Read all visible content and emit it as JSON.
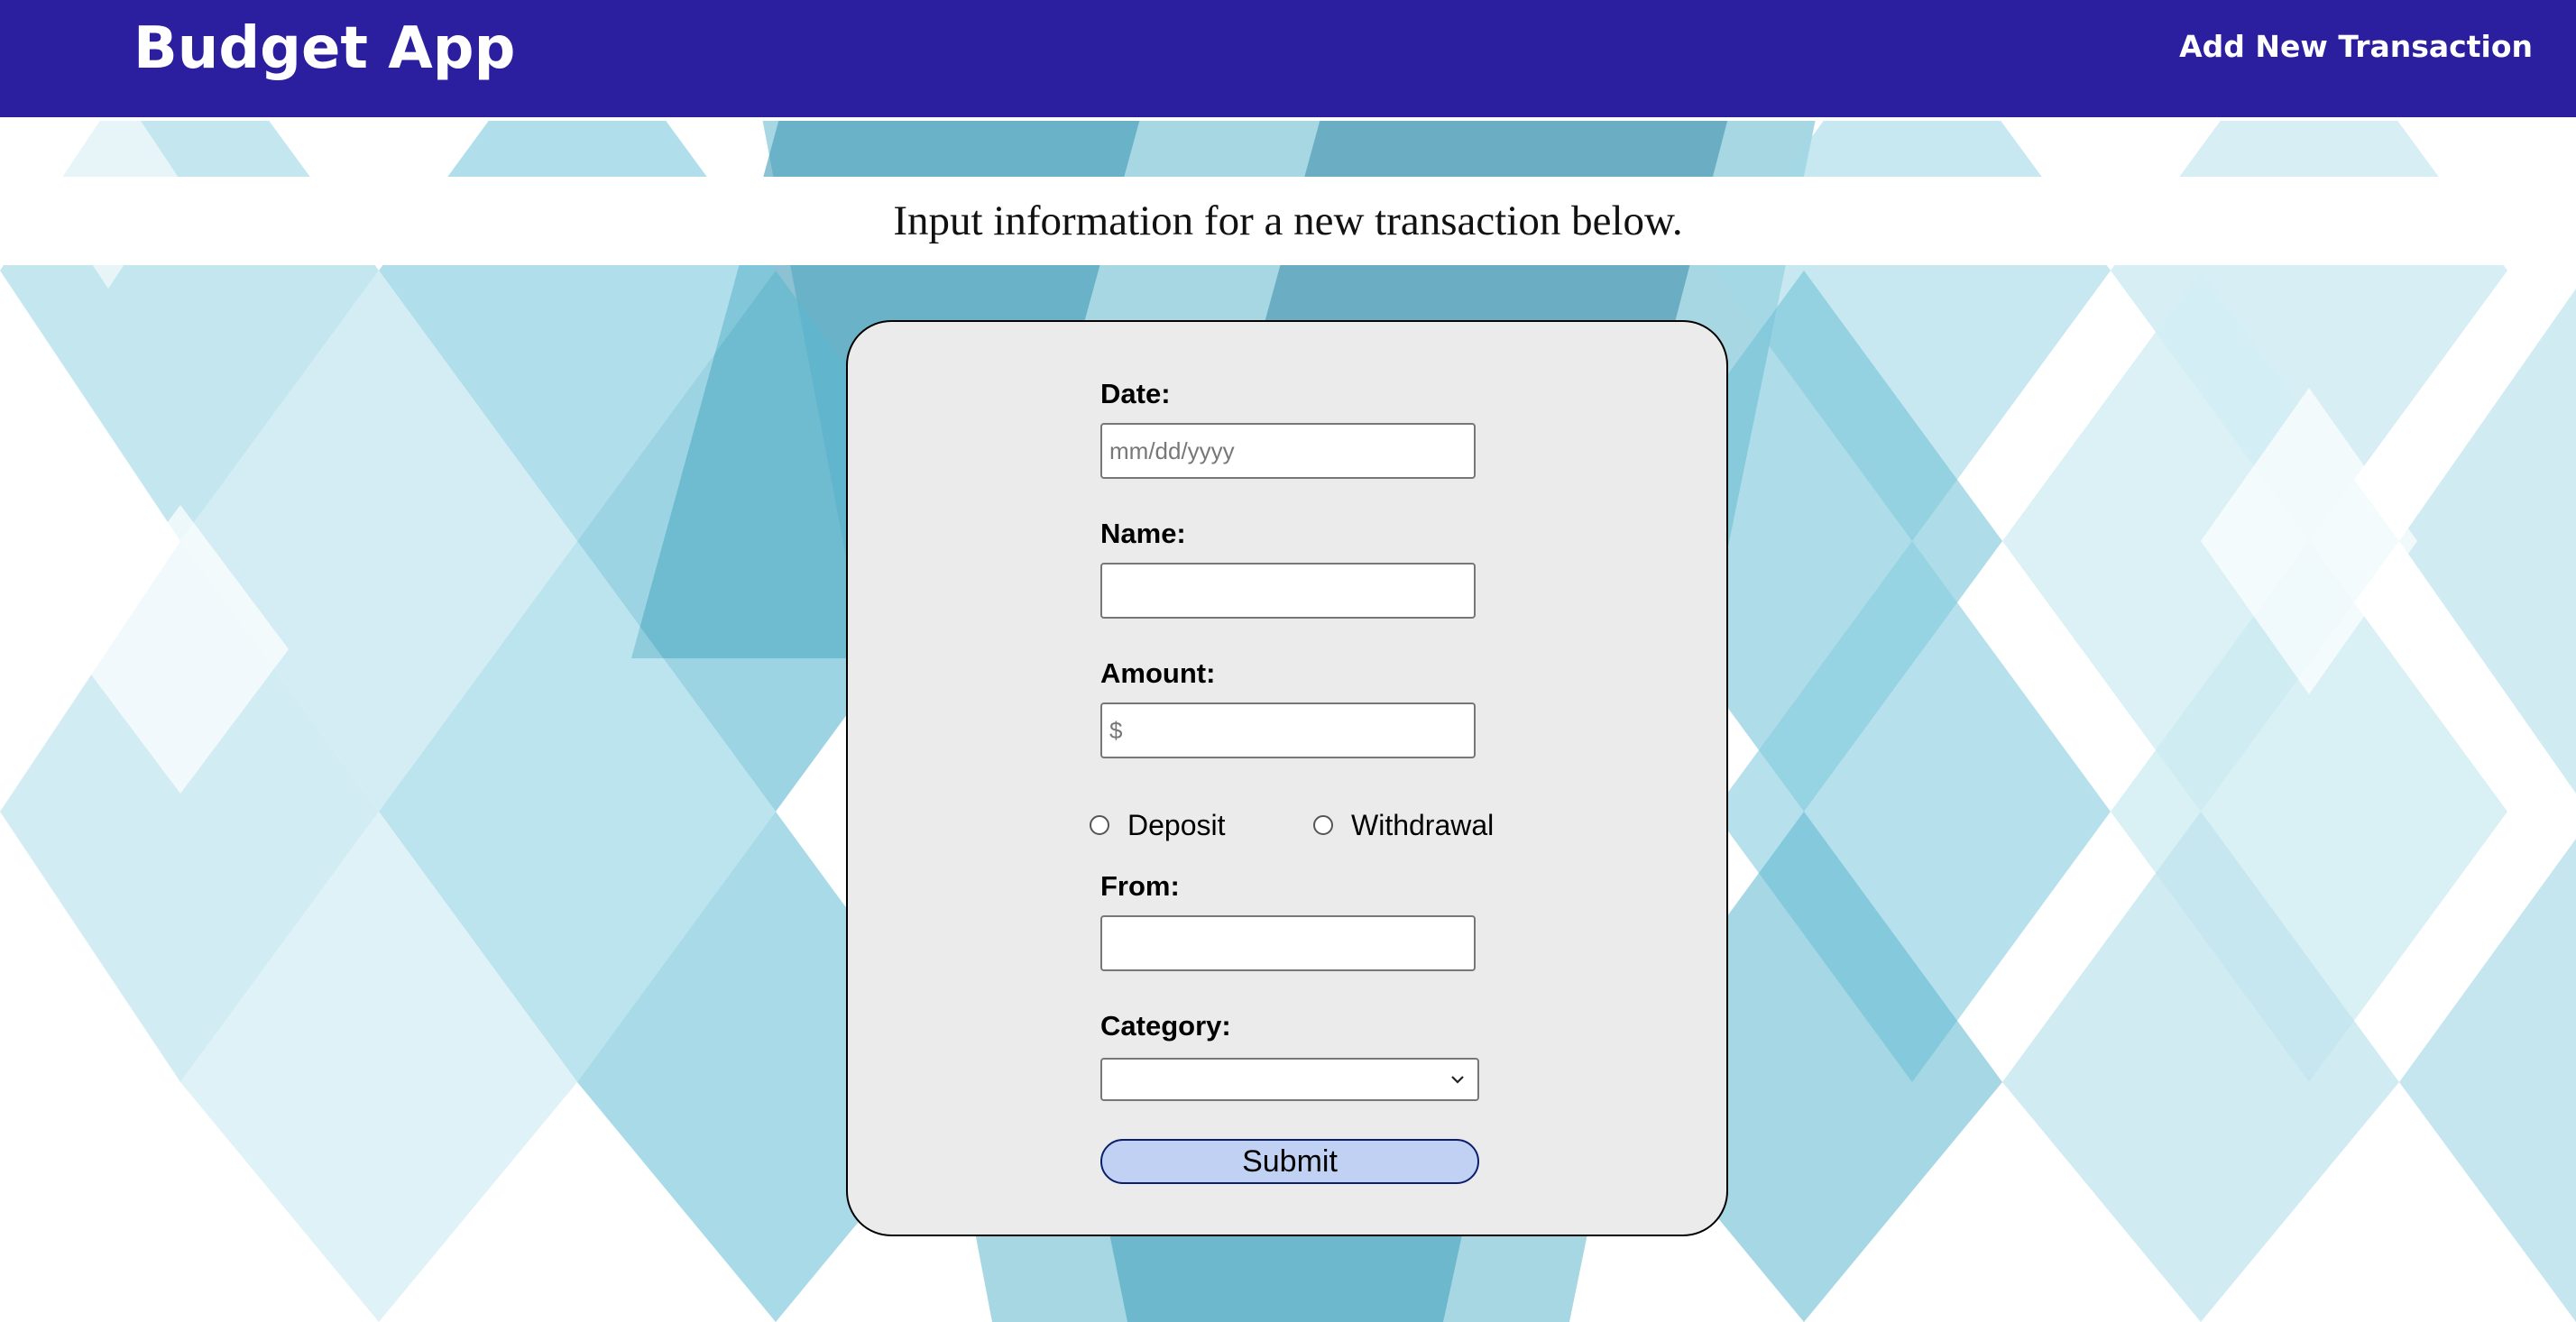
{
  "navbar": {
    "brand": "Budget App",
    "link": "Add New Transaction"
  },
  "banner": {
    "text": "Input information for a new transaction below."
  },
  "form": {
    "date": {
      "label": "Date:",
      "placeholder": "mm/dd/yyyy",
      "value": ""
    },
    "name": {
      "label": "Name:",
      "placeholder": "",
      "value": ""
    },
    "amount": {
      "label": "Amount:",
      "placeholder": "$",
      "value": ""
    },
    "type": {
      "options": [
        {
          "label": "Deposit",
          "checked": false
        },
        {
          "label": "Withdrawal",
          "checked": false
        }
      ]
    },
    "from": {
      "label": "From:",
      "placeholder": "",
      "value": ""
    },
    "category": {
      "label": "Category:",
      "selected": ""
    },
    "submit_label": "Submit"
  },
  "colors": {
    "navbar": "#2b1fa0",
    "card": "#ecebec",
    "submit_bg": "#c0d1f3",
    "submit_border": "#0b1f6e"
  },
  "background": {
    "pattern": "blue-teal geometric triangle mosaic"
  }
}
